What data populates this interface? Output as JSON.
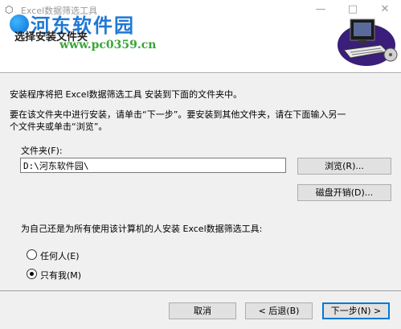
{
  "window": {
    "title": "Excel数据筛选工具",
    "app_icon": "installer-icon",
    "minimize_glyph": "—",
    "maximize_glyph": "□",
    "close_glyph": "✕"
  },
  "watermark": {
    "title": "河东软件园",
    "url": "www.pc0359.cn"
  },
  "header": {
    "heading": "选择安装文件夹"
  },
  "body": {
    "intro": "安装程序将把 Excel数据筛选工具 安装到下面的文件夹中。",
    "instruction_line1": "要在该文件夹中进行安装，请单击“下一步”。要安装到其他文件夹，请在下面输入另一",
    "instruction_line2": "个文件夹或单击“浏览”。",
    "folder_label": "文件夹(F):",
    "folder_value": "D:\\河东软件园\\",
    "browse_label": "浏览(R)...",
    "disk_cost_label": "磁盘开销(D)...",
    "install_for_label": "为自己还是为所有使用该计算机的人安装 Excel数据筛选工具:",
    "options": [
      {
        "label": "任何人(E)",
        "selected": false
      },
      {
        "label": "只有我(M)",
        "selected": true
      }
    ]
  },
  "footer": {
    "cancel_label": "取消",
    "back_label": "< 后退(B)",
    "next_label": "下一步(N) >"
  }
}
